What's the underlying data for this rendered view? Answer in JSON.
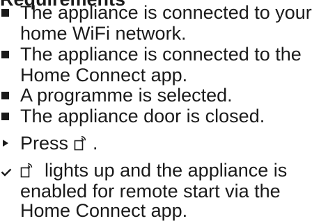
{
  "heading": "Requirements",
  "requirements": [
    {
      "lines": [
        "The appliance is connected to your",
        "home WiFi network."
      ]
    },
    {
      "lines": [
        "The appliance is connected to the",
        "Home Connect app."
      ]
    },
    {
      "lines": [
        "A programme is selected."
      ]
    },
    {
      "lines": [
        "The appliance door is closed."
      ]
    }
  ],
  "step": {
    "before": "Press ",
    "icon": "remote-start-icon",
    "after": "."
  },
  "result": {
    "icon": "remote-start-icon",
    "line1_after": "lights up and the appliance is",
    "line2": "enabled for remote start via the",
    "line3": "Home Connect app."
  }
}
